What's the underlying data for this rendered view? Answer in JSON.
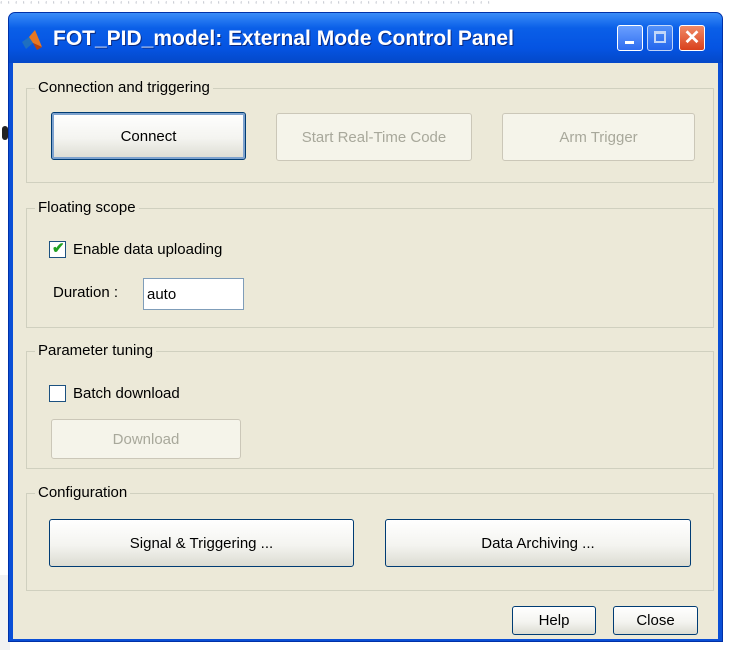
{
  "window": {
    "title": "FOT_PID_model: External Mode Control Panel"
  },
  "connection": {
    "label": "Connection and triggering",
    "connect_label": "Connect",
    "start_label": "Start Real-Time Code",
    "arm_label": "Arm Trigger"
  },
  "scope": {
    "label": "Floating scope",
    "enable_label": "Enable data uploading",
    "enable_checked": true,
    "duration_label": "Duration :",
    "duration_value": "auto"
  },
  "tuning": {
    "label": "Parameter tuning",
    "batch_label": "Batch download",
    "batch_checked": false,
    "download_label": "Download"
  },
  "config": {
    "label": "Configuration",
    "signal_label": "Signal & Triggering ...",
    "archive_label": "Data Archiving ..."
  },
  "footer": {
    "help_label": "Help",
    "close_label": "Close"
  }
}
